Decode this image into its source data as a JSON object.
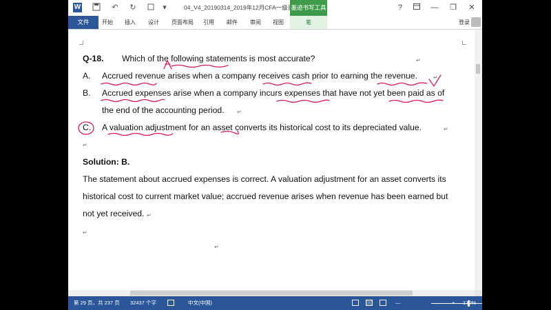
{
  "window": {
    "title": "04_V4_20190314_2019年12月CFA一级百题...",
    "ink_tools_tab": "墨迹书写工具",
    "help": "?",
    "restore": "□",
    "minimize": "—",
    "maximize": "❐",
    "close": "✕"
  },
  "quick_access": {
    "word": "W",
    "save": "💾",
    "undo": "↶",
    "redo": "↻",
    "more": "▾"
  },
  "ribbon": {
    "file": "文件",
    "tabs": [
      "开始",
      "插入",
      "设计",
      "页面布局",
      "引用",
      "邮件",
      "审阅",
      "视图"
    ],
    "pen": "笔",
    "signin": "登录"
  },
  "document": {
    "question": {
      "num": "Q-18.",
      "text": "Which of the following statements is most accurate?"
    },
    "options": [
      {
        "label": "A.",
        "text": "Accrued revenue arises when a company receives cash prior to earning the revenue."
      },
      {
        "label": "B.",
        "text": "Accrued expenses arise when a company incurs expenses that have not yet been paid as of",
        "text2": "the end of the accounting period."
      },
      {
        "label": "C.",
        "text": "A valuation adjustment for an asset converts its historical cost to its depreciated value."
      }
    ],
    "solution_title": "Solution: B.",
    "solution_lines": [
      "The statement about accrued expenses is correct. A valuation adjustment for an asset converts its",
      "historical cost to current market value; accrued revenue arises when revenue has been earned but",
      "not yet received."
    ],
    "return_mark": "↵"
  },
  "status": {
    "page": "第 29 页，共 237 页",
    "words": "32437 个字",
    "proof_icon": "proofing-icon",
    "language": "中文(中国)",
    "zoom": "170%",
    "zoom_minus": "—",
    "zoom_plus": "+"
  },
  "colors": {
    "accent": "#2b579a",
    "ink_tools": "#3f9b4a",
    "ink": "#d81b60"
  }
}
